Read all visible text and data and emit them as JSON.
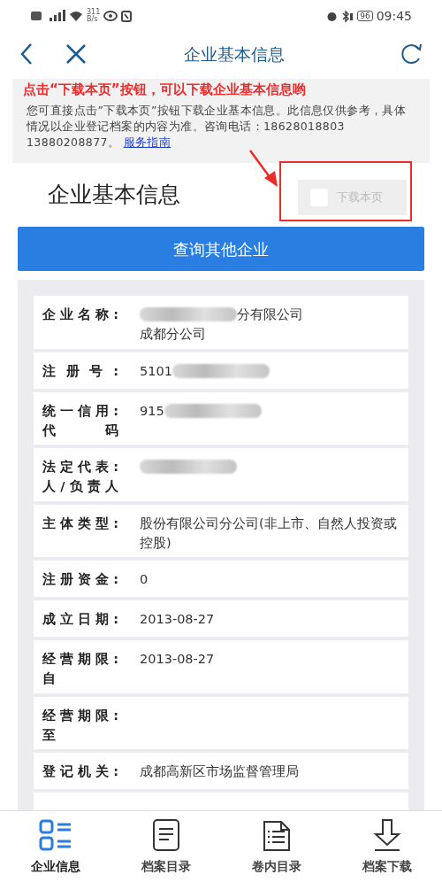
{
  "status_bar": {
    "network_speed": "311",
    "speed_unit": "B/s",
    "battery": "96",
    "time": "09:45"
  },
  "header": {
    "title": "企业基本信息"
  },
  "annotation": {
    "text": "点击“下载本页”按钮，可以下载企业基本信息哟"
  },
  "notice": {
    "text": "您可直接点击”下载本页”按钮下载企业基本信息。此信息仅供参考，具体情况以企业登记档案的内容为准。咨询电话：18628018803 13880208877。",
    "link": "服务指南"
  },
  "section": {
    "heading": "企业基本信息",
    "download": {
      "label": "下载本页",
      "checked": false
    }
  },
  "query_button": "查询其他企业",
  "fields": [
    {
      "label": [
        "企业名称:"
      ],
      "value": [
        {
          "kind": "redacted"
        },
        {
          "kind": "text",
          "text": "分有限公司"
        },
        {
          "kind": "break"
        },
        {
          "kind": "text",
          "text": "成都分公司"
        }
      ]
    },
    {
      "label": [
        "注册号:"
      ],
      "value": [
        {
          "kind": "text",
          "text": "5101"
        },
        {
          "kind": "redacted"
        }
      ]
    },
    {
      "label": [
        "统一信用:",
        "代码"
      ],
      "value": [
        {
          "kind": "text",
          "text": "915"
        },
        {
          "kind": "redacted"
        }
      ]
    },
    {
      "label": [
        "法定代表:",
        "人/负责人"
      ],
      "value": [
        {
          "kind": "redacted"
        }
      ]
    },
    {
      "label": [
        "主体类型:"
      ],
      "value": [
        {
          "kind": "text",
          "text": "股份有限公司分公司(非上市、自然人投资或控股)"
        }
      ]
    },
    {
      "label": [
        "注册资金:"
      ],
      "value": [
        {
          "kind": "text",
          "text": "0"
        }
      ]
    },
    {
      "label": [
        "成立日期:"
      ],
      "value": [
        {
          "kind": "text",
          "text": "2013-08-27"
        }
      ]
    },
    {
      "label": [
        "经营期限:",
        "自"
      ],
      "value": [
        {
          "kind": "text",
          "text": "2013-08-27"
        }
      ]
    },
    {
      "label": [
        "经营期限:",
        "至"
      ]
    },
    {
      "label": [
        "登记机关:"
      ],
      "value": [
        {
          "kind": "text",
          "text": "成都高新区市场监督管理局"
        }
      ]
    }
  ],
  "tabs": [
    {
      "label": "企业信息",
      "kind": "info",
      "selected": true
    },
    {
      "label": "档案目录",
      "kind": "doc",
      "selected": false
    },
    {
      "label": "卷内目录",
      "kind": "list",
      "selected": false
    },
    {
      "label": "档案下载",
      "kind": "download",
      "selected": false
    }
  ]
}
